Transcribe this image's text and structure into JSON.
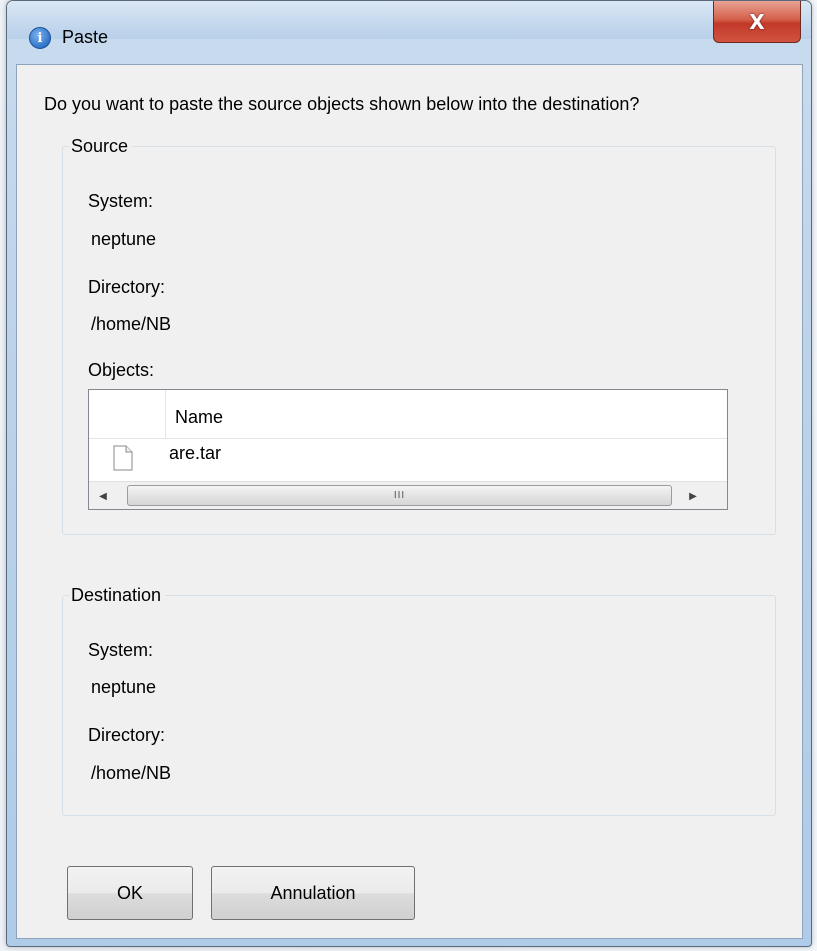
{
  "window": {
    "title": "Paste",
    "close_glyph": "X",
    "title_icon": "info-icon"
  },
  "dialog": {
    "question": "Do you want to paste the source objects shown below into the destination?"
  },
  "source": {
    "legend": "Source",
    "system_label": "System:",
    "system_value": "neptune",
    "directory_label": "Directory:",
    "directory_value": "/home/NB",
    "objects_label": "Objects:",
    "table": {
      "columns": [
        "",
        "Name"
      ],
      "rows": [
        {
          "icon": "file-icon",
          "name": "are.tar"
        }
      ],
      "scroll_thumb_glyph": "III"
    }
  },
  "destination": {
    "legend": "Destination",
    "system_label": "System:",
    "system_value": "neptune",
    "directory_label": "Directory:",
    "directory_value": "/home/NB"
  },
  "buttons": {
    "ok": "OK",
    "cancel": "Annulation"
  }
}
